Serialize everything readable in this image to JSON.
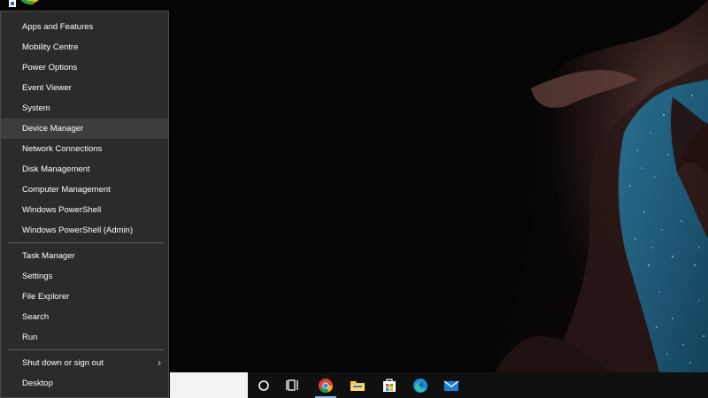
{
  "winx_menu": {
    "group1": [
      {
        "label": "Apps and Features"
      },
      {
        "label": "Mobility Centre"
      },
      {
        "label": "Power Options"
      },
      {
        "label": "Event Viewer"
      },
      {
        "label": "System"
      },
      {
        "label": "Device Manager",
        "highlighted": true
      },
      {
        "label": "Network Connections"
      },
      {
        "label": "Disk Management"
      },
      {
        "label": "Computer Management"
      },
      {
        "label": "Windows PowerShell"
      },
      {
        "label": "Windows PowerShell (Admin)"
      }
    ],
    "group2": [
      {
        "label": "Task Manager"
      },
      {
        "label": "Settings"
      },
      {
        "label": "File Explorer"
      },
      {
        "label": "Search"
      },
      {
        "label": "Run"
      }
    ],
    "group3": [
      {
        "label": "Shut down or sign out",
        "submenu_icon": "chevron-right-icon"
      },
      {
        "label": "Desktop"
      }
    ]
  },
  "taskbar": {
    "search_value": "",
    "icons": [
      {
        "name": "cortana-icon"
      },
      {
        "name": "task-view-icon"
      },
      {
        "name": "chrome-icon",
        "active": true
      },
      {
        "name": "file-explorer-icon"
      },
      {
        "name": "microsoft-store-icon"
      },
      {
        "name": "edge-icon"
      },
      {
        "name": "mail-icon"
      }
    ]
  },
  "desktop": {
    "icons": [
      {
        "name": "desktop-shortcut-icon"
      }
    ]
  },
  "colors": {
    "menu_bg": "#2b2b2b",
    "menu_highlight": "#3d3d3d",
    "taskbar_bg": "#101010",
    "accent": "#8ab4e8"
  }
}
